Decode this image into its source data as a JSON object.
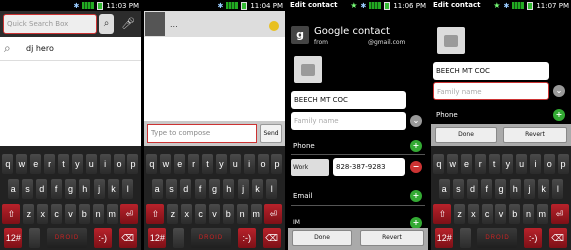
{
  "panel1": {
    "status_time": "11:03 PM",
    "search_placeholder": "Quick Search Box",
    "result_text": "dj hero"
  },
  "panel2": {
    "status_time": "11:04 PM",
    "contact_name": "...",
    "compose_placeholder": "Type to compose",
    "send_label": "Send"
  },
  "panel3": {
    "status_time": "11:06 PM",
    "title": "Edit contact",
    "account_name": "Google contact",
    "account_from": "from",
    "account_email": "@gmail.com",
    "first_name": "BEECH MT COC",
    "family_placeholder": "Family name",
    "phone_label": "Phone",
    "phone_type": "Work",
    "phone_number": "828-387-9283",
    "email_label": "Email",
    "im_label": "IM",
    "done_label": "Done",
    "revert_label": "Revert"
  },
  "panel4": {
    "status_time": "11:07 PM",
    "title": "Edit contact",
    "first_name": "BEECH MT COC",
    "family_placeholder": "Family name",
    "phone_label": "Phone",
    "done_label": "Done",
    "revert_label": "Revert"
  },
  "keyboard": {
    "row1": [
      "q",
      "w",
      "e",
      "r",
      "t",
      "y",
      "u",
      "i",
      "o",
      "p"
    ],
    "row2": [
      "a",
      "s",
      "d",
      "f",
      "g",
      "h",
      "j",
      "k",
      "l"
    ],
    "row3": [
      "z",
      "x",
      "c",
      "v",
      "b",
      "n",
      "m"
    ],
    "sym": "12#",
    "logo": "DROID",
    "smiley": ":-)"
  }
}
